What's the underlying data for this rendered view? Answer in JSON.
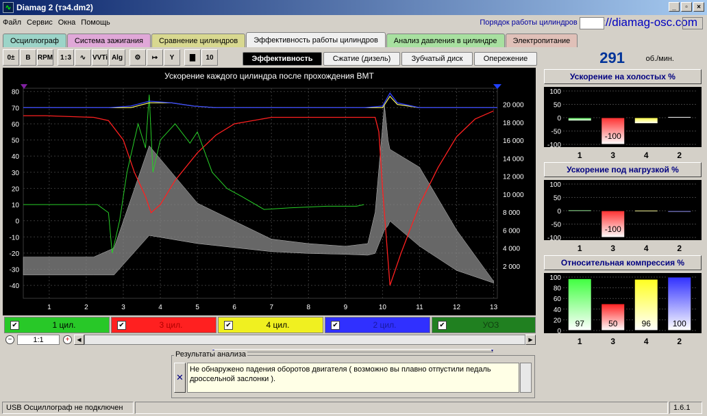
{
  "window": {
    "title": "Diamag 2 (тэ4.dm2)",
    "min": "_",
    "max": "▫",
    "close": "×"
  },
  "menu": {
    "items": [
      "Файл",
      "Сервис",
      "Окна",
      "Помощь"
    ],
    "order_label": "Порядок работы цилиндров",
    "url": "http://diamag-osc.com"
  },
  "tabs": [
    {
      "label": "Осциллограф",
      "color": "#9cd4c8"
    },
    {
      "label": "Система зажигания",
      "color": "#e0a8d8"
    },
    {
      "label": "Сравнение цилиндров",
      "color": "#d8d890"
    },
    {
      "label": "Эффективность работы цилиндров",
      "color": "#f0f0f0",
      "active": true
    },
    {
      "label": "Анализ давления в цилиндре",
      "color": "#a8e0a0"
    },
    {
      "label": "Электропитание",
      "color": "#e0c0b8"
    }
  ],
  "toolbar": {
    "icons": [
      "settings-step-icon",
      "bold-icon",
      "rpm-icon",
      "cylinder-order-icon",
      "waveform-icon",
      "vvti-icon",
      "algorithm-icon",
      "injector-icon",
      "counter-icon",
      "filter-icon",
      "bar-chart-icon",
      "scale-icon"
    ],
    "glyphs": [
      "0±",
      "B",
      "RPM",
      "1↕3",
      "∿",
      "VVTi",
      "Alg",
      "⚙",
      "↦",
      "Y",
      "▇",
      "10"
    ]
  },
  "subtabs": [
    "Эффективность",
    "Сжатие (дизель)",
    "Зубчатый диск",
    "Опережение"
  ],
  "rpm": {
    "value": "291",
    "unit": "об./мин."
  },
  "chart_data": [
    {
      "type": "line",
      "title": "Ускорение каждого цилиндра после прохождения ВМТ",
      "x_ticks": [
        "1",
        "2",
        "3",
        "4",
        "5",
        "6",
        "7",
        "8",
        "9",
        "10",
        "11",
        "12",
        "13"
      ],
      "xlim": [
        0.3,
        13.1
      ],
      "y_left_ticks": [
        "80",
        "70",
        "60",
        "50",
        "40",
        "30",
        "20",
        "10",
        "0",
        "-10",
        "-20",
        "-30",
        "-40"
      ],
      "ylim_left": [
        -48,
        82
      ],
      "y_right_ticks": [
        "20 000",
        "18 000",
        "16 000",
        "14 000",
        "12 000",
        "10 000",
        "8 000",
        "6 000",
        "4 000",
        "2 000"
      ],
      "ylim_right": [
        -1600,
        21800
      ],
      "grid": true,
      "series": [
        {
          "color": "#ff2020",
          "x": [
            0.3,
            0.9,
            2.2,
            2.6,
            3.0,
            3.3,
            3.6,
            3.75,
            4.0,
            4.4,
            5.0,
            5.5,
            6.0,
            7.0,
            8.0,
            9.0,
            9.8,
            9.9,
            10.0,
            10.1,
            10.2,
            10.5,
            11.0,
            11.5,
            12.0,
            12.5,
            13.0
          ],
          "y": [
            65,
            65,
            64,
            62,
            50,
            30,
            15,
            5,
            10,
            25,
            42,
            53,
            60,
            64,
            64,
            64,
            64,
            55,
            20,
            -10,
            -40,
            -20,
            10,
            33,
            52,
            63,
            68
          ]
        },
        {
          "color": "#28d028",
          "x": [
            0.3,
            1.5,
            2.3,
            2.6,
            2.7,
            2.9,
            3.1,
            3.4,
            3.6,
            3.7,
            3.8,
            4.0,
            4.4,
            4.8,
            5.0,
            5.4,
            5.8,
            6.2,
            6.8,
            7.5,
            8.5,
            9.3,
            9.5
          ],
          "y": [
            10,
            10,
            10,
            5,
            -20,
            0,
            30,
            60,
            45,
            78,
            30,
            50,
            60,
            48,
            55,
            30,
            20,
            15,
            7,
            8,
            9,
            9,
            10
          ]
        },
        {
          "color": "#e8e860",
          "x": [
            0.3,
            2.6,
            3.2,
            3.7,
            4.3,
            4.9,
            5.5,
            9.5,
            10.0,
            10.2,
            10.4,
            11.0,
            13.1
          ],
          "y": [
            70,
            70,
            70,
            73,
            73,
            71,
            70,
            70,
            70,
            77,
            72,
            70,
            70
          ]
        },
        {
          "color": "#3040ff",
          "x": [
            0.3,
            2.6,
            3.2,
            3.7,
            4.3,
            4.9,
            5.5,
            9.5,
            10.0,
            10.2,
            10.4,
            11.0,
            13.1
          ],
          "y": [
            70,
            70,
            71,
            74,
            73,
            71,
            70,
            70,
            71,
            79,
            73,
            70,
            70
          ]
        },
        {
          "color": "#c0c0c0",
          "envelope_x": [
            0.3,
            2.2,
            2.75,
            3.7,
            5.0,
            7.0,
            8.0,
            9.0,
            9.6,
            9.8,
            10.05,
            10.15,
            10.2,
            11.0,
            12.0,
            13.0
          ],
          "envelope_y_top": [
            3000,
            3000,
            4000,
            15400,
            9000,
            5000,
            4500,
            4200,
            4500,
            8000,
            20000,
            16000,
            15000,
            13000,
            6000,
            300
          ],
          "envelope_y_bottom": [
            1000,
            1000,
            1000,
            5400,
            4500,
            3600,
            3400,
            3300,
            3200,
            3400,
            6000,
            6500,
            7000,
            4200,
            1500,
            100
          ]
        }
      ]
    },
    {
      "type": "bar",
      "title": "Ускорение на холостых %",
      "categories": [
        "1",
        "3",
        "4",
        "2"
      ],
      "values": [
        -12,
        -100,
        -22,
        4
      ],
      "value_labels": [
        "",
        "-100",
        "",
        ""
      ],
      "colors": [
        "#40e040",
        "#ff3030",
        "#ffff40",
        "#ffffff"
      ],
      "y_ticks": [
        "100",
        "50",
        "0",
        "-50",
        "-100"
      ],
      "ylim": [
        -100,
        100
      ]
    },
    {
      "type": "bar",
      "title": "Ускорение под нагрузкой %",
      "categories": [
        "1",
        "3",
        "4",
        "2"
      ],
      "values": [
        3,
        -100,
        2,
        0
      ],
      "value_labels": [
        "",
        "-100",
        "",
        ""
      ],
      "colors": [
        "#40e040",
        "#ff3030",
        "#ffff40",
        "#3030ff"
      ],
      "y_ticks": [
        "100",
        "50",
        "0",
        "-50",
        "-100"
      ],
      "ylim": [
        -100,
        100
      ]
    },
    {
      "type": "bar",
      "title": "Относительная компрессия %",
      "categories": [
        "1",
        "3",
        "4",
        "2"
      ],
      "values": [
        97,
        50,
        96,
        100
      ],
      "value_labels": [
        "97",
        "50",
        "96",
        "100"
      ],
      "colors": [
        "#40ff40",
        "#ff2020",
        "#ffff20",
        "#3030ff"
      ],
      "y_ticks": [
        "100",
        "80",
        "60",
        "40",
        "20",
        "0"
      ],
      "ylim": [
        0,
        100
      ]
    }
  ],
  "channels": [
    {
      "label": "1 цил.",
      "color": "#28c828",
      "text": "#000"
    },
    {
      "label": "3 цил.",
      "color": "#ff2020",
      "text": "#b00000"
    },
    {
      "label": "4 цил.",
      "color": "#f0f020",
      "text": "#000"
    },
    {
      "label": "2 цил.",
      "color": "#3030ff",
      "text": "#1818a0"
    },
    {
      "label": "УОЗ",
      "color": "#208020",
      "text": "#104010"
    }
  ],
  "scale": {
    "value": "1:1",
    "minus": "−",
    "plus": "+"
  },
  "results": {
    "title": "Результаты анализа",
    "text": "Не обнаружено падения оборотов двигателя ( возможно вы плавно отпустили педаль дроссельной заслонки )."
  },
  "status": {
    "left": "USB Осциллограф не подключен",
    "version": "1.6.1"
  }
}
